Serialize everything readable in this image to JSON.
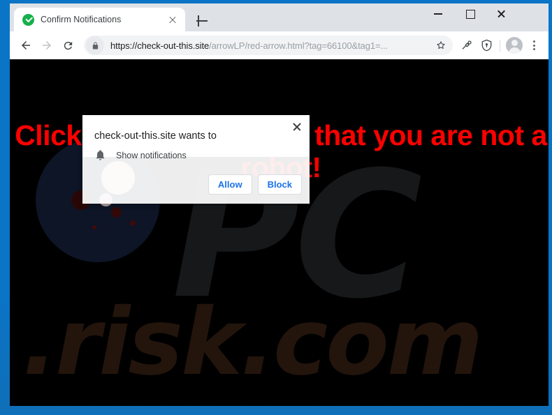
{
  "window": {
    "controls": {
      "minimize_label": "Minimize",
      "maximize_label": "Maximize",
      "close_label": "Close"
    }
  },
  "tab_strip": {
    "tabs": [
      {
        "title": "Confirm Notifications",
        "favicon": "green-check-icon",
        "close_label": "Close tab"
      }
    ],
    "new_tab_label": "New tab"
  },
  "toolbar": {
    "back_label": "Back",
    "forward_label": "Forward",
    "reload_label": "Reload this page",
    "omnibox": {
      "lock_icon": "lock-icon",
      "url_host": "https://check-out-this.site",
      "url_path": "/arrowLP/red-arrow.html?tag=66100&tag1=...",
      "bookmark_icon": "star-icon"
    },
    "extension_icon": "extension-puzzle-icon",
    "shield_icon": "shield-icon",
    "avatar_icon": "profile-avatar-icon",
    "menu_icon": "three-dot-menu-icon"
  },
  "page": {
    "headline": "Click Allow to confirm that you are not a robot!",
    "watermark_top": "PC",
    "watermark_bottom": ".risk.com",
    "background_color": "#000000",
    "headline_color": "#fe0000"
  },
  "permission_dialog": {
    "title": "check-out-this.site wants to",
    "permission_icon": "bell-icon",
    "permission_label": "Show notifications",
    "allow_label": "Allow",
    "block_label": "Block",
    "close_label": "Close",
    "accent_color": "#1a73e8"
  }
}
